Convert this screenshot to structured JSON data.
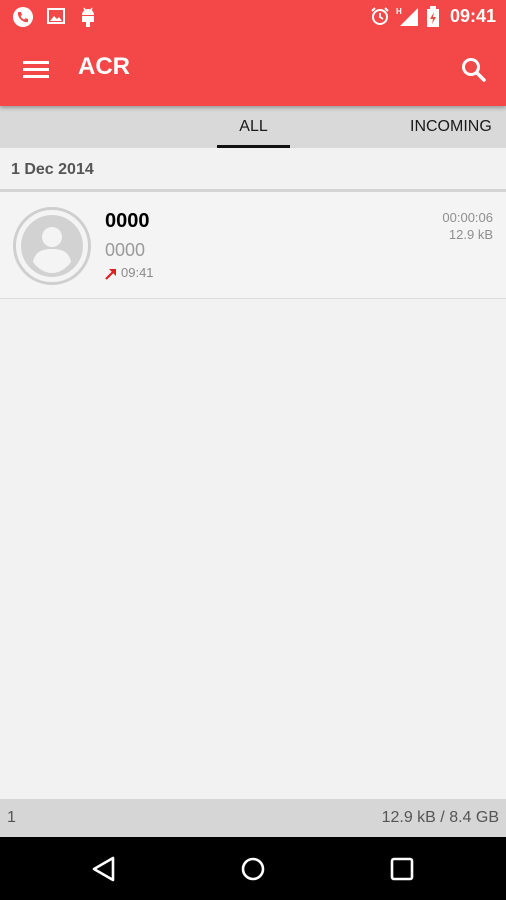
{
  "status_bar": {
    "time": "09:41",
    "left_icons": [
      "phone-call-icon",
      "image-icon",
      "android-debug-icon"
    ],
    "right_icons": [
      "alarm-icon",
      "signal-h-icon",
      "battery-charging-icon"
    ]
  },
  "toolbar": {
    "title": "ACR",
    "menu_icon": "hamburger-menu-icon",
    "search_icon": "search-icon",
    "color": "#f44747"
  },
  "tabs": [
    {
      "label": "ALL",
      "selected": true
    },
    {
      "label": "INCOMING",
      "selected": false
    }
  ],
  "section": {
    "date": "1 Dec 2014"
  },
  "records": [
    {
      "name": "0000",
      "number": "0000",
      "time": "09:41",
      "direction_icon": "outgoing-call-arrow-icon",
      "duration": "00:00:06",
      "size": "12.9 kB"
    }
  ],
  "footer": {
    "count": "1",
    "storage": "12.9 kB / 8.4 GB"
  },
  "nav_bar": {
    "icons": [
      "back-icon",
      "home-icon",
      "recents-icon"
    ]
  },
  "colors": {
    "accent": "#f44747",
    "outgoing_arrow": "#e02020"
  }
}
